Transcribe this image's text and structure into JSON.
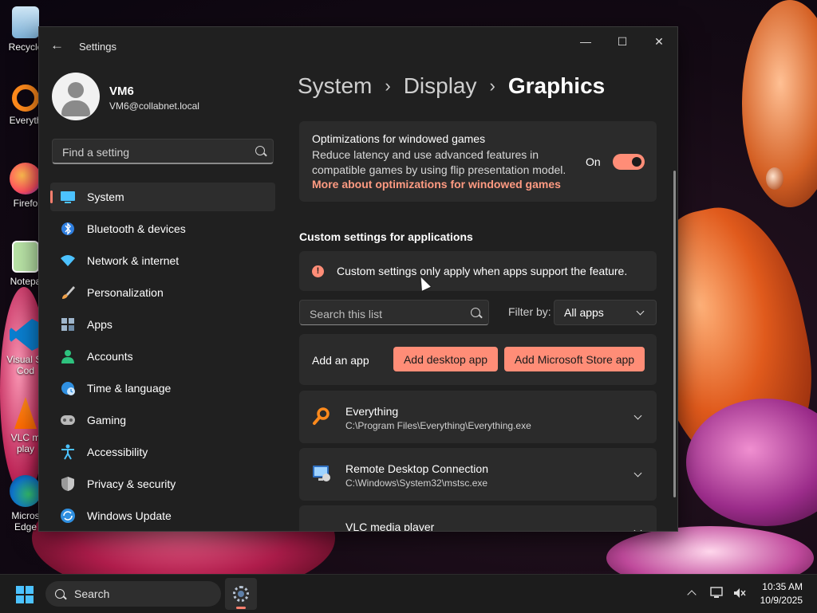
{
  "desktop": {
    "icons": [
      {
        "label": "Recycle"
      },
      {
        "label": "Everyth"
      },
      {
        "label": "Firefo"
      },
      {
        "label": "Notepa"
      },
      {
        "label": "Visual St Cod"
      },
      {
        "label": "VLC m play"
      },
      {
        "label": "Micros Edge"
      }
    ]
  },
  "window": {
    "title": "Settings",
    "controls": {
      "minimize": "—",
      "maximize": "☐",
      "close": "✕"
    }
  },
  "profile": {
    "name": "VM6",
    "email": "VM6@collabnet.local"
  },
  "sidebar": {
    "search_placeholder": "Find a setting",
    "items": [
      {
        "label": "System",
        "icon": "monitor-icon",
        "active": true
      },
      {
        "label": "Bluetooth & devices",
        "icon": "bluetooth-icon"
      },
      {
        "label": "Network & internet",
        "icon": "wifi-icon"
      },
      {
        "label": "Personalization",
        "icon": "brush-icon"
      },
      {
        "label": "Apps",
        "icon": "apps-icon"
      },
      {
        "label": "Accounts",
        "icon": "person-icon"
      },
      {
        "label": "Time & language",
        "icon": "globe-clock-icon"
      },
      {
        "label": "Gaming",
        "icon": "gamepad-icon"
      },
      {
        "label": "Accessibility",
        "icon": "accessibility-icon"
      },
      {
        "label": "Privacy & security",
        "icon": "shield-icon"
      },
      {
        "label": "Windows Update",
        "icon": "update-icon"
      }
    ]
  },
  "breadcrumb": {
    "items": [
      "System",
      "Display"
    ],
    "separator": "›",
    "current": "Graphics"
  },
  "windowed_games": {
    "title": "Optimizations for windowed games",
    "description": "Reduce latency and use advanced features in compatible games by using flip presentation model.",
    "link": "More about optimizations for windowed games",
    "toggle_label": "On",
    "toggle_on": true
  },
  "custom_settings": {
    "section_title": "Custom settings for applications",
    "info_text": "Custom settings only apply when apps support the feature.",
    "search_placeholder": "Search this list",
    "filter_label": "Filter by:",
    "filter_value": "All apps",
    "add_label": "Add an app",
    "add_desktop_button": "Add desktop app",
    "add_store_button": "Add Microsoft Store app"
  },
  "apps": [
    {
      "name": "Everything",
      "path": "C:\\Program Files\\Everything\\Everything.exe",
      "icon": "magnifier-icon"
    },
    {
      "name": "Remote Desktop Connection",
      "path": "C:\\Windows\\System32\\mstsc.exe",
      "icon": "remote-desktop-icon"
    },
    {
      "name": "VLC media player",
      "path": "",
      "icon": "vlc-cone-icon"
    }
  ],
  "taskbar": {
    "search_label": "Search",
    "clock": {
      "time": "10:35 AM",
      "date": "10/9/2025"
    }
  },
  "colors": {
    "accent": "#ff8d77",
    "window_bg": "#202020",
    "card_bg": "#2b2b2b",
    "start_blue": "#4cc2ff"
  }
}
